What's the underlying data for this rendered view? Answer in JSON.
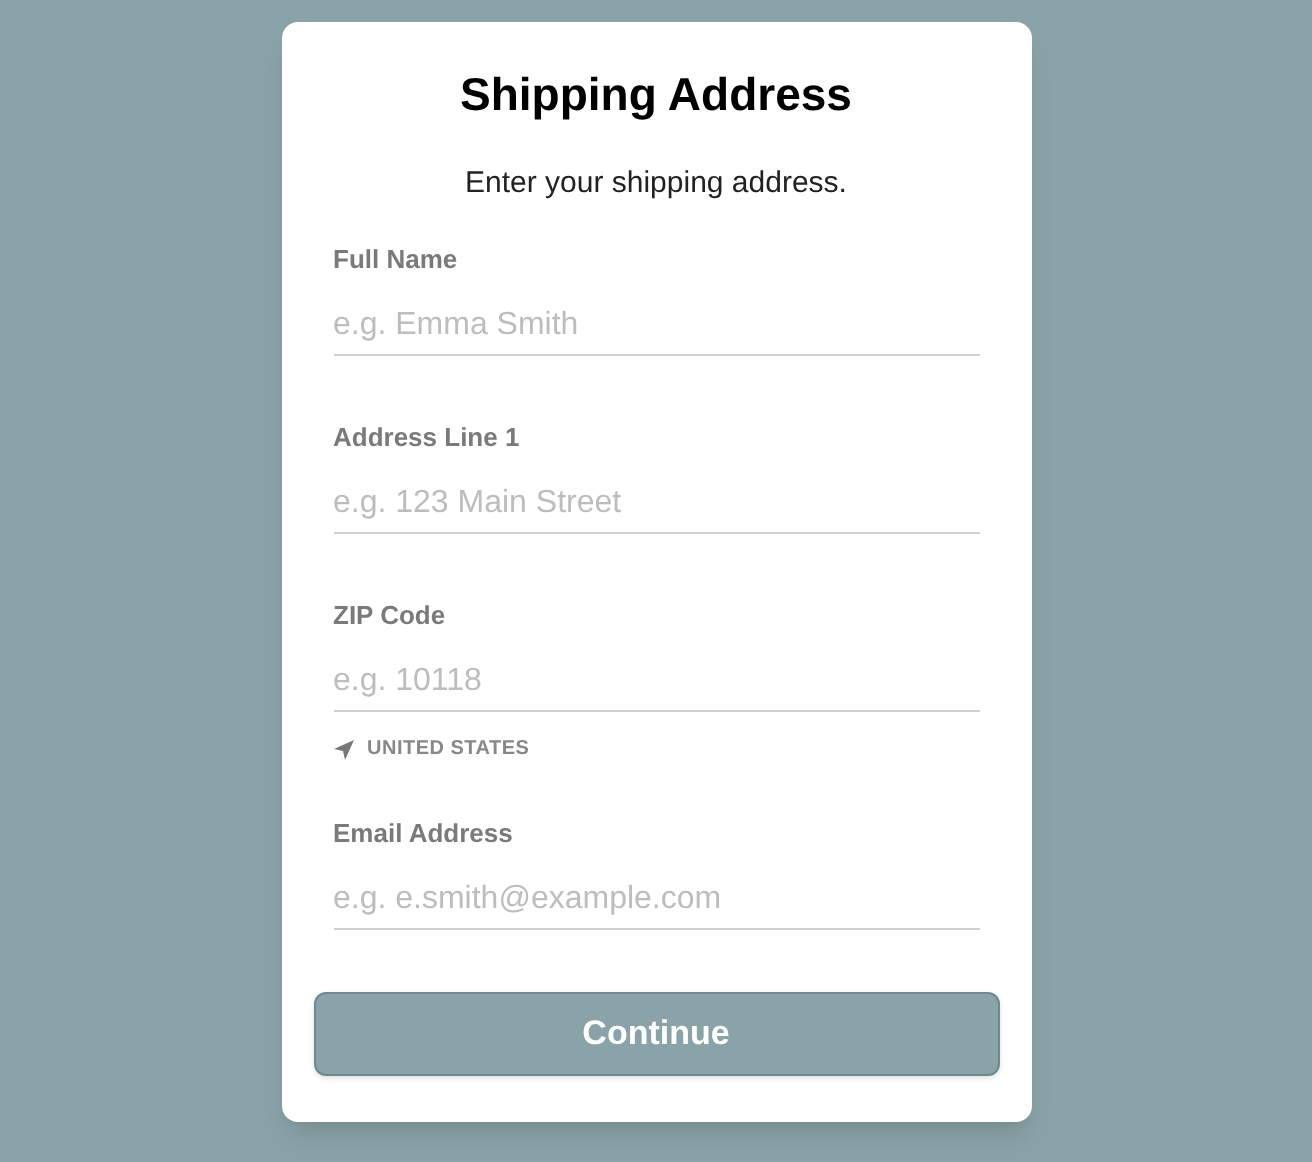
{
  "title": "Shipping Address",
  "subtitle": "Enter your shipping address.",
  "fields": [
    {
      "label": "Full Name",
      "placeholder": "e.g. Emma Smith"
    },
    {
      "label": "Address Line 1",
      "placeholder": "e.g. 123 Main Street"
    },
    {
      "label": "ZIP Code",
      "placeholder": "e.g. 10118",
      "location": "UNITED STATES"
    },
    {
      "label": "Email Address",
      "placeholder": "e.g. e.smith@example.com"
    }
  ],
  "button": "Continue"
}
